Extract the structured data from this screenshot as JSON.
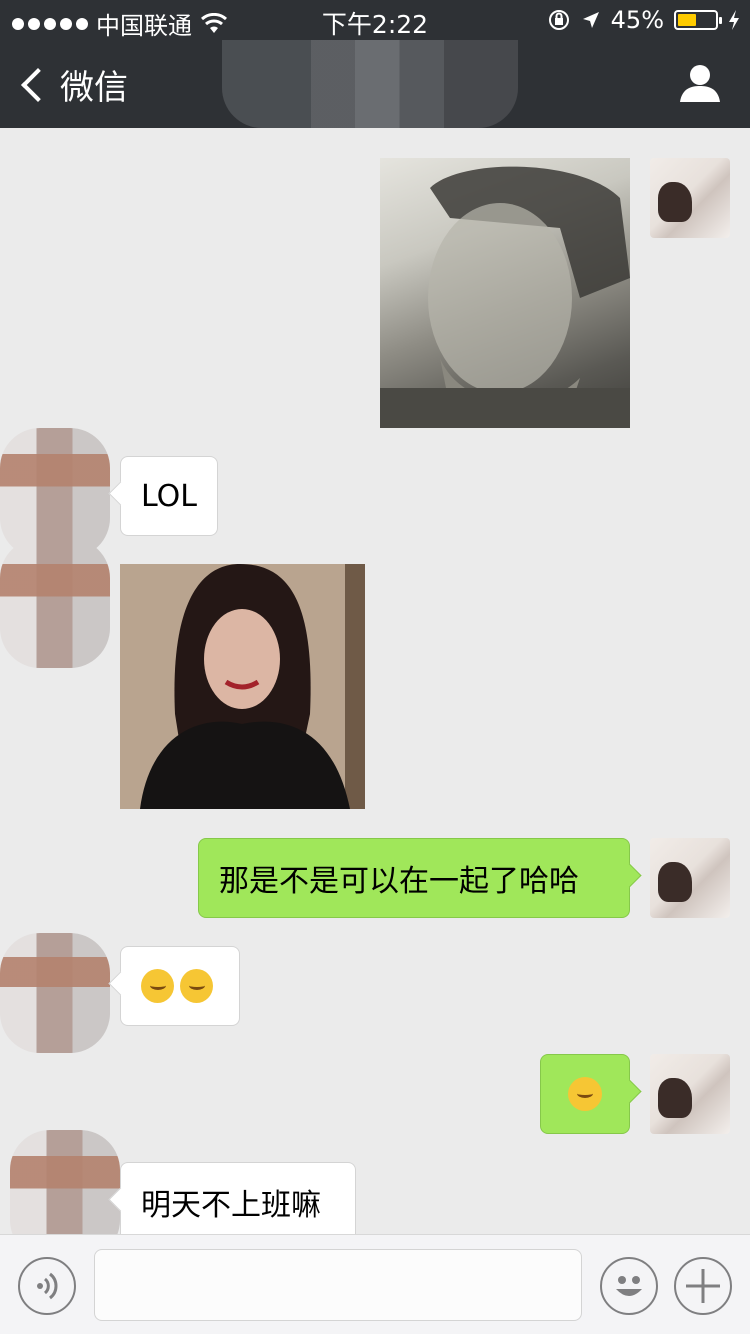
{
  "status_bar": {
    "carrier": "中国联通",
    "time": "下午2:22",
    "battery_percent": "45%",
    "battery_level": 0.45
  },
  "nav": {
    "back_label": "微信",
    "title": ""
  },
  "messages": [
    {
      "side": "out",
      "type": "image",
      "description_icon": "photo-icon"
    },
    {
      "side": "in",
      "type": "text",
      "text": "LOL"
    },
    {
      "side": "in",
      "type": "image",
      "description_icon": "photo-icon"
    },
    {
      "side": "out",
      "type": "text",
      "text": "那是不是可以在一起了哈哈"
    },
    {
      "side": "in",
      "type": "emoji",
      "icons": [
        "thinking-face-icon",
        "thinking-face-icon"
      ]
    },
    {
      "side": "out",
      "type": "emoji",
      "icons": [
        "hugging-face-icon"
      ]
    },
    {
      "side": "in",
      "type": "text",
      "text": "明天不上班嘛"
    }
  ],
  "input": {
    "value": "",
    "placeholder": ""
  },
  "colors": {
    "nav_bg": "#2e3135",
    "chat_bg": "#ebebeb",
    "outgoing_bubble": "#a0e75a",
    "incoming_bubble": "#ffffff",
    "battery_fill": "#ffcc00"
  }
}
